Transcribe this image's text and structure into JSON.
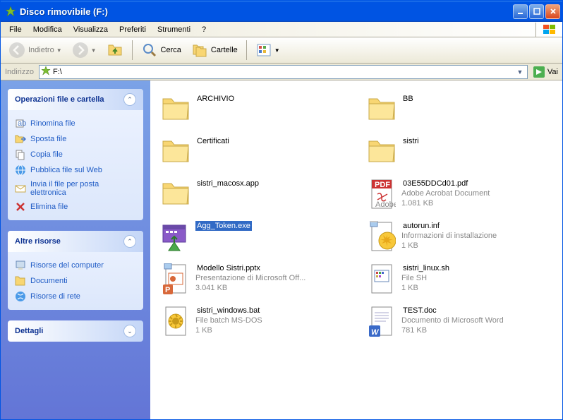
{
  "window": {
    "title": "Disco rimovibile (F:)"
  },
  "menubar": [
    "File",
    "Modifica",
    "Visualizza",
    "Preferiti",
    "Strumenti",
    "?"
  ],
  "toolbar": {
    "back": "Indietro",
    "search": "Cerca",
    "folders": "Cartelle"
  },
  "address": {
    "label": "Indirizzo",
    "path": "F:\\",
    "go": "Vai"
  },
  "sidebar": {
    "tasks": {
      "title": "Operazioni file e cartella",
      "items": [
        {
          "icon": "rename",
          "label": "Rinomina file"
        },
        {
          "icon": "move",
          "label": "Sposta file"
        },
        {
          "icon": "copy",
          "label": "Copia file"
        },
        {
          "icon": "web",
          "label": "Pubblica file sul Web"
        },
        {
          "icon": "mail",
          "label": "Invia il file per posta elettronica"
        },
        {
          "icon": "delete",
          "label": "Elimina file"
        }
      ]
    },
    "other": {
      "title": "Altre risorse",
      "items": [
        {
          "icon": "computer",
          "label": "Risorse del computer"
        },
        {
          "icon": "docs",
          "label": "Documenti"
        },
        {
          "icon": "network",
          "label": "Risorse di rete"
        }
      ]
    },
    "details": {
      "title": "Dettagli"
    }
  },
  "files": [
    {
      "type": "folder",
      "name": "ARCHIVIO",
      "meta1": "",
      "meta2": ""
    },
    {
      "type": "folder",
      "name": "BB",
      "meta1": "",
      "meta2": ""
    },
    {
      "type": "folder",
      "name": "Certificati",
      "meta1": "",
      "meta2": ""
    },
    {
      "type": "folder",
      "name": "sistri",
      "meta1": "",
      "meta2": ""
    },
    {
      "type": "folder",
      "name": "sistri_macosx.app",
      "meta1": "",
      "meta2": ""
    },
    {
      "type": "pdf",
      "name": "03E55DDCd01.pdf",
      "meta1": "Adobe Acrobat Document",
      "meta2": "1.081 KB"
    },
    {
      "type": "exe",
      "name": "Agg_Token.exe",
      "meta1": "",
      "meta2": "",
      "selected": true
    },
    {
      "type": "inf",
      "name": "autorun.inf",
      "meta1": "Informazioni di installazione",
      "meta2": "1 KB"
    },
    {
      "type": "pptx",
      "name": "Modello Sistri.pptx",
      "meta1": "Presentazione di Microsoft Off...",
      "meta2": "3.041 KB"
    },
    {
      "type": "sh",
      "name": "sistri_linux.sh",
      "meta1": "File SH",
      "meta2": "1 KB"
    },
    {
      "type": "bat",
      "name": "sistri_windows.bat",
      "meta1": "File batch MS-DOS",
      "meta2": "1 KB"
    },
    {
      "type": "doc",
      "name": "TEST.doc",
      "meta1": "Documento di Microsoft Word",
      "meta2": "781 KB"
    }
  ]
}
